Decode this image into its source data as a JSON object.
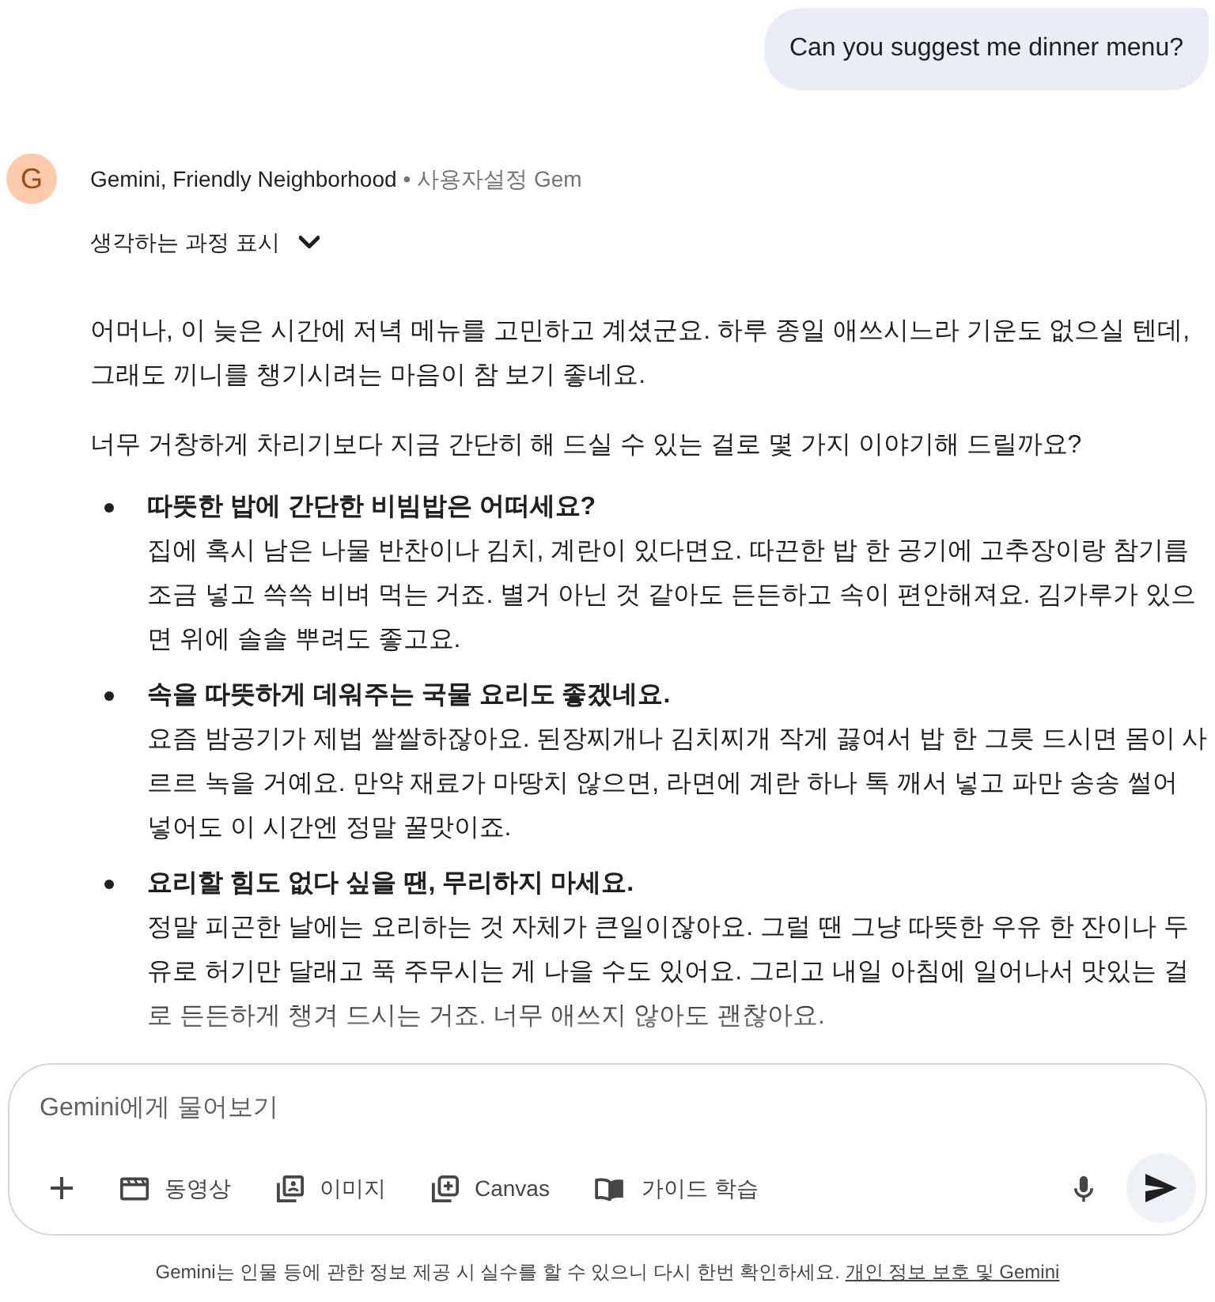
{
  "conversation": {
    "user_message": {
      "text": "Can you suggest me dinner menu?"
    },
    "response": {
      "avatar": {
        "letter": "G"
      },
      "author": "Gemini, Friendly Neighborhood",
      "author_tag": "• 사용자설정 Gem",
      "thinking_toggle": {
        "label": "생각하는 과정 표시",
        "expanded": false
      },
      "paragraphs": [
        "어머나, 이 늦은 시간에 저녁 메뉴를 고민하고 계셨군요. 하루 종일 애쓰시느라 기운도 없으실 텐데, 그래도 끼니를 챙기시려는 마음이 참 보기 좋네요.",
        "너무 거창하게 차리기보다 지금 간단히 해 드실 수 있는 걸로 몇 가지 이야기해 드릴까요?"
      ],
      "list_items": [
        {
          "title": "따뜻한 밥에 간단한 비빔밥은 어떠세요?",
          "body": "집에 혹시 남은 나물 반찬이나 김치, 계란이 있다면요. 따끈한 밥 한 공기에 고추장이랑 참기름 조금 넣고 쓱쓱 비벼 먹는 거죠. 별거 아닌 것 같아도 든든하고 속이 편안해져요. 김가루가 있으면 위에 솔솔 뿌려도 좋고요."
        },
        {
          "title": "속을 따뜻하게 데워주는 국물 요리도 좋겠네요.",
          "body": "요즘 밤공기가 제법 쌀쌀하잖아요. 된장찌개나 김치찌개 작게 끓여서 밥 한 그릇 드시면 몸이 사르르 녹을 거예요. 만약 재료가 마땅치 않으면, 라면에 계란 하나 톡 깨서 넣고 파만 송송 썰어 넣어도 이 시간엔 정말 꿀맛이죠."
        },
        {
          "title": "요리할 힘도 없다 싶을 땐, 무리하지 마세요.",
          "body": "정말 피곤한 날에는 요리하는 것 자체가 큰일이잖아요. 그럴 땐 그냥 따뜻한 우유 한 잔이나 두유로 허기만 달래고 푹 주무시는 게 나을 수도 있어요. 그리고 내일 아침에 일어나서 맛있는 걸로 든든하게 챙겨 드시는 거죠. 너무 애쓰지 않아도 괜찮아요."
        }
      ]
    }
  },
  "composer": {
    "placeholder": "Gemini에게 물어보기",
    "tools": [
      {
        "label": "동영상"
      },
      {
        "label": "이미지"
      },
      {
        "label": "Canvas"
      },
      {
        "label": "가이드 학습"
      }
    ]
  },
  "footer": {
    "notice": "Gemini는 인물 등에 관한 정보 제공 시 실수를 할 수 있으니 다시 한번 확인하세요.",
    "link": "개인 정보 보호 및 Gemini"
  }
}
